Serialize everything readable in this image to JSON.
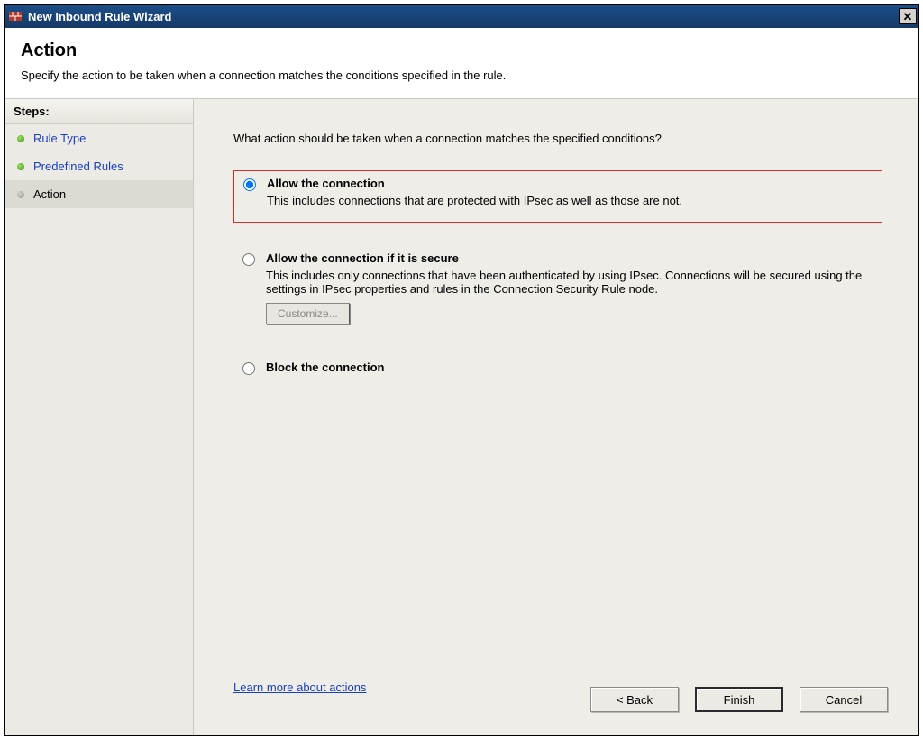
{
  "window": {
    "title": "New Inbound Rule Wizard"
  },
  "header": {
    "title": "Action",
    "subtitle": "Specify the action to be taken when a connection matches the conditions specified in the rule."
  },
  "sidebar": {
    "heading": "Steps:",
    "items": [
      {
        "label": "Rule Type",
        "link": true,
        "current": false
      },
      {
        "label": "Predefined Rules",
        "link": true,
        "current": false
      },
      {
        "label": "Action",
        "link": false,
        "current": true
      }
    ]
  },
  "main": {
    "question": "What action should be taken when a connection matches the specified conditions?",
    "options": {
      "allow": {
        "title": "Allow the connection",
        "desc": "This includes connections that are protected with IPsec as well as those are not."
      },
      "allow_secure": {
        "title": "Allow the connection if it is secure",
        "desc": "This includes only connections that have been authenticated by using IPsec.  Connections will be secured using the settings in IPsec properties and rules in the Connection Security Rule node.",
        "customize_label": "Customize..."
      },
      "block": {
        "title": "Block the connection"
      }
    },
    "learn_more": "Learn more about actions"
  },
  "buttons": {
    "back": "< Back",
    "finish": "Finish",
    "cancel": "Cancel"
  }
}
